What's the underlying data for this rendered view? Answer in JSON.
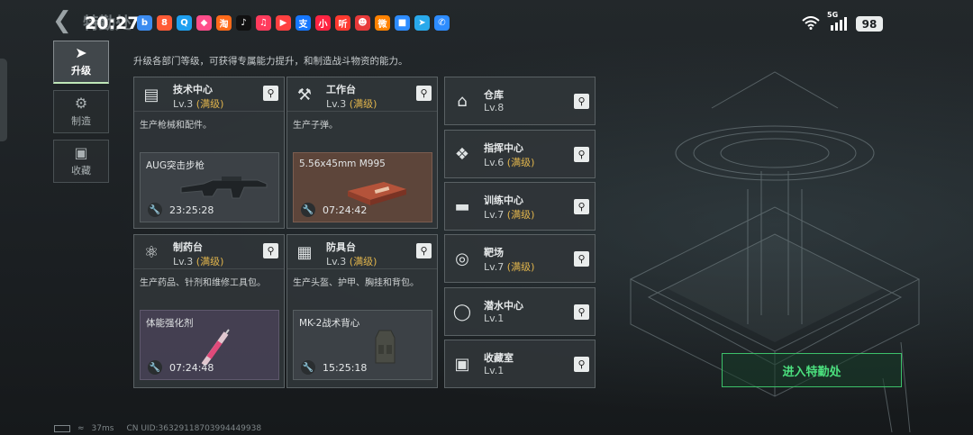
{
  "status_bar": {
    "time": "20:27",
    "ghost_title": "特勤处",
    "network": "5G",
    "battery": "98",
    "apps": [
      {
        "icon": "bilibili-icon",
        "glyph": "b",
        "color": "#3c8cf0"
      },
      {
        "icon": "app-icon-orange",
        "glyph": "8",
        "color": "#ff5b36"
      },
      {
        "icon": "qq-icon",
        "glyph": "Q",
        "color": "#1ea0f0"
      },
      {
        "icon": "app-icon-pink",
        "glyph": "◆",
        "color": "#ff4d8a"
      },
      {
        "icon": "taobao-icon",
        "glyph": "淘",
        "color": "#ff6a1a"
      },
      {
        "icon": "douyin-icon",
        "glyph": "♪",
        "color": "#111111"
      },
      {
        "icon": "music-icon",
        "glyph": "♫",
        "color": "#ff3b5c"
      },
      {
        "icon": "video-icon",
        "glyph": "▶",
        "color": "#ff4040"
      },
      {
        "icon": "alipay-icon",
        "glyph": "支",
        "color": "#1677ff"
      },
      {
        "icon": "xiaohongshu-icon",
        "glyph": "小",
        "color": "#ff2442"
      },
      {
        "icon": "ting-icon",
        "glyph": "听",
        "color": "#ff3a30"
      },
      {
        "icon": "app-icon-mascot",
        "glyph": "☻",
        "color": "#e83a3a"
      },
      {
        "icon": "weibo-icon",
        "glyph": "微",
        "color": "#ff8200"
      },
      {
        "icon": "app-icon-blue",
        "glyph": "■",
        "color": "#2d8cff"
      },
      {
        "icon": "telegram-icon",
        "glyph": "➤",
        "color": "#29a9eb"
      },
      {
        "icon": "phone-icon",
        "glyph": "✆",
        "color": "#2d8cff"
      }
    ]
  },
  "sidebar": {
    "tabs": [
      {
        "label": "升级",
        "icon": "upgrade-icon",
        "active": true
      },
      {
        "label": "制造",
        "icon": "gears-icon",
        "active": false
      },
      {
        "label": "收藏",
        "icon": "collection-icon",
        "active": false
      }
    ]
  },
  "subtitle": "升级各部门等级，可获得专属能力提升，和制造战斗物资的能力。",
  "big_cards": [
    {
      "name": "技术中心",
      "level": "Lv.3",
      "max": "(满级)",
      "desc": "生产枪械和配件。",
      "item": "AUG突击步枪",
      "timer": "23:25:28",
      "icon": "tech-center-icon"
    },
    {
      "name": "工作台",
      "level": "Lv.3",
      "max": "(满级)",
      "desc": "生产子弹。",
      "item": "5.56x45mm M995",
      "timer": "07:24:42",
      "icon": "workbench-icon"
    },
    {
      "name": "制药台",
      "level": "Lv.3",
      "max": "(满级)",
      "desc": "生产药品、针剂和维修工具包。",
      "item": "体能强化剂",
      "timer": "07:24:48",
      "icon": "pharmacy-icon"
    },
    {
      "name": "防具台",
      "level": "Lv.3",
      "max": "(满级)",
      "desc": "生产头盔、护甲、胸挂和背包。",
      "item": "MK-2战术背心",
      "timer": "15:25:18",
      "icon": "armor-bench-icon"
    }
  ],
  "small_cards": [
    {
      "name": "仓库",
      "level": "Lv.8",
      "max": "",
      "icon": "warehouse-icon"
    },
    {
      "name": "指挥中心",
      "level": "Lv.6",
      "max": "(满级)",
      "icon": "command-center-icon"
    },
    {
      "name": "训练中心",
      "level": "Lv.7",
      "max": "(满级)",
      "icon": "training-center-icon"
    },
    {
      "name": "靶场",
      "level": "Lv.7",
      "max": "(满级)",
      "icon": "shooting-range-icon"
    },
    {
      "name": "潜水中心",
      "level": "Lv.1",
      "max": "",
      "icon": "diving-center-icon"
    },
    {
      "name": "收藏室",
      "level": "Lv.1",
      "max": "",
      "icon": "collection-room-icon"
    }
  ],
  "enter_button": "进入特勤处",
  "footer": {
    "ping": "37ms",
    "uid": "CN UID:363291187039944499​38"
  }
}
